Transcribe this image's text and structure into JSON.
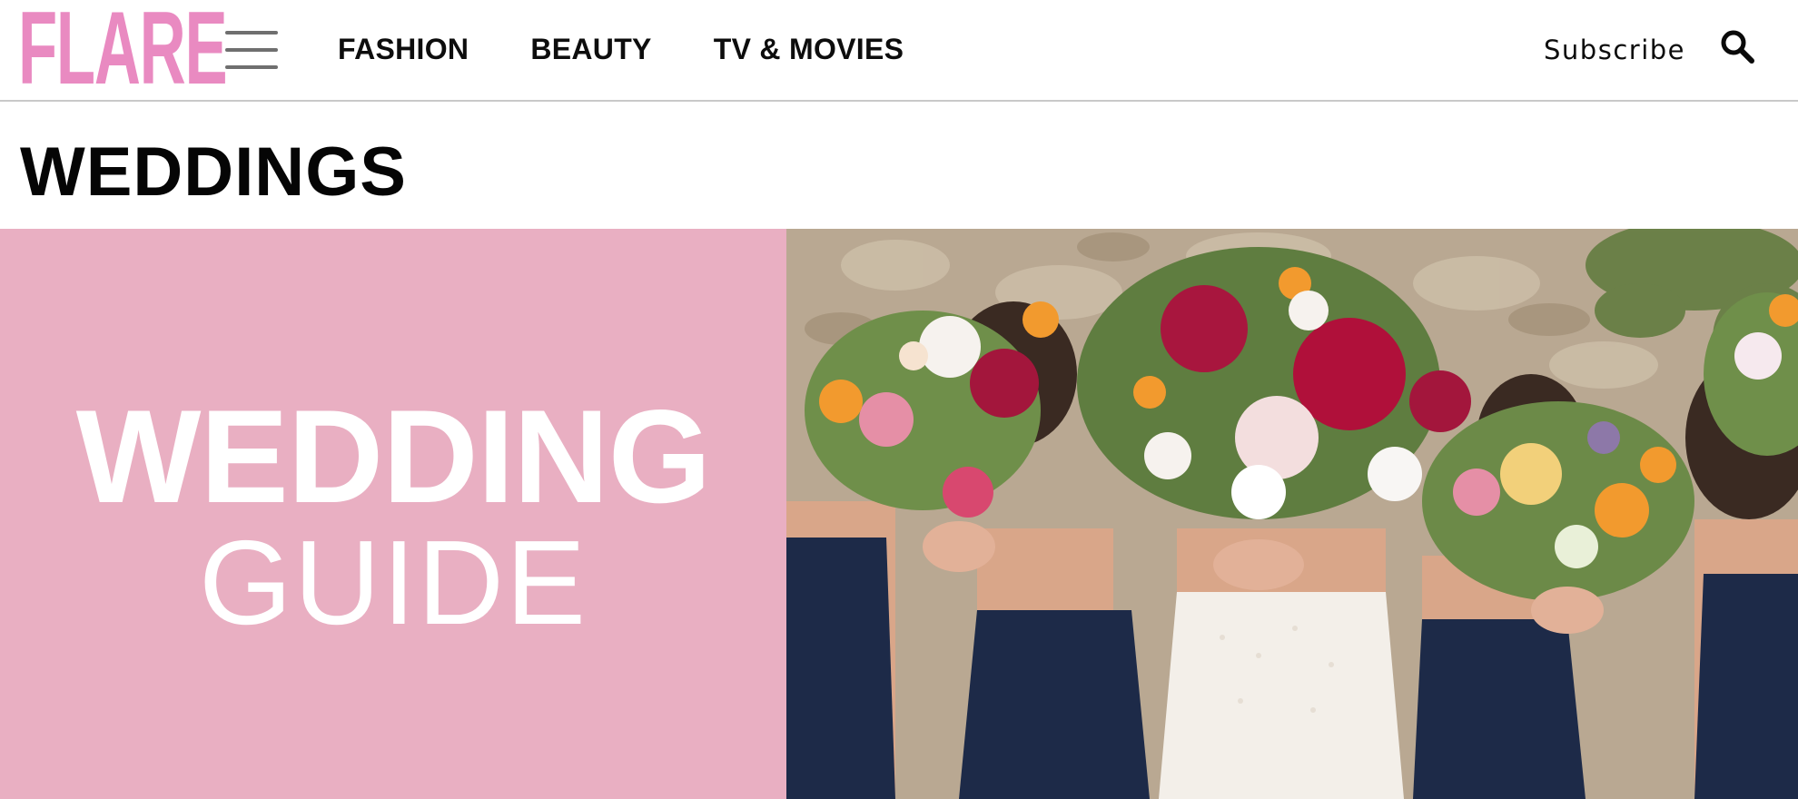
{
  "header": {
    "logo": "FLARE",
    "nav": [
      "FASHION",
      "BEAUTY",
      "TV & MOVIES"
    ],
    "subscribe": "Subscribe",
    "icons": {
      "menu": "hamburger-menu-icon",
      "search": "search-icon"
    }
  },
  "page": {
    "title": "WEDDINGS"
  },
  "hero": {
    "line1": "WEDDING",
    "line2": "GUIDE",
    "photo_icon": "bridal-party-bouquets-photo"
  },
  "colors": {
    "brand_pink": "#e98ac1",
    "hero_pink": "#e9afc2",
    "dress_navy": "#1d2a48"
  }
}
